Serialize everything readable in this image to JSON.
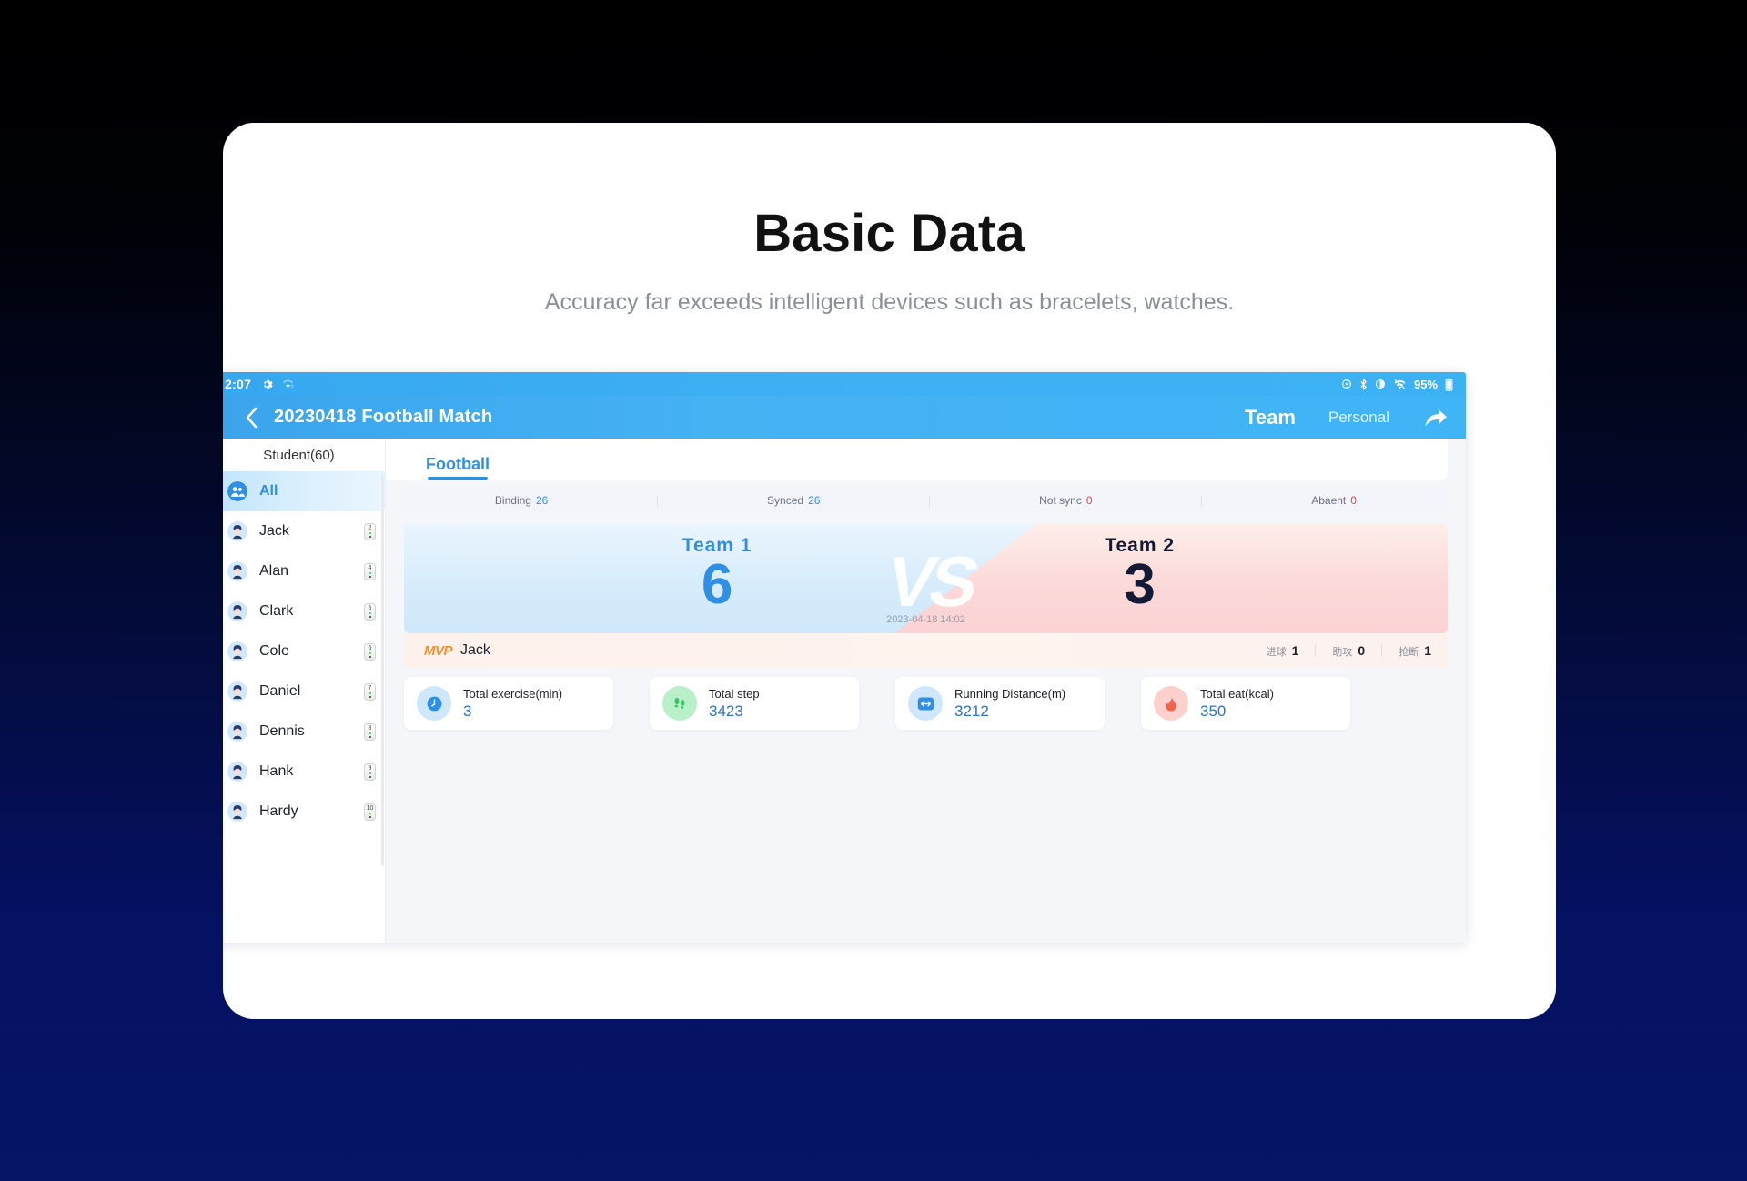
{
  "hero": {
    "title": "Basic Data",
    "subtitle": "Accuracy far exceeds intelligent devices such as bracelets, watches."
  },
  "status_bar": {
    "time": "2:07",
    "left_icons": [
      "gear-icon",
      "wifi-weak-icon"
    ],
    "right_icons": [
      "location-icon",
      "bluetooth-icon",
      "do-not-disturb-icon",
      "wifi-icon"
    ],
    "battery": "95%"
  },
  "nav": {
    "back": "back-arrow-icon",
    "title": "20230418 Football Match",
    "tab_team": "Team",
    "tab_personal": "Personal",
    "share": "share-icon"
  },
  "sidebar": {
    "header": "Student(60)",
    "all_label": "All",
    "students": [
      {
        "name": "Jack",
        "device": "2"
      },
      {
        "name": "Alan",
        "device": "4"
      },
      {
        "name": "Clark",
        "device": "5"
      },
      {
        "name": "Cole",
        "device": "6"
      },
      {
        "name": "Daniel",
        "device": "7"
      },
      {
        "name": "Dennis",
        "device": "8"
      },
      {
        "name": "Hank",
        "device": "9"
      },
      {
        "name": "Hardy",
        "device": "10"
      }
    ]
  },
  "content": {
    "tab": "Football",
    "sync_stats": [
      {
        "label": "Binding",
        "value": "26",
        "tone": "blue"
      },
      {
        "label": "Synced",
        "value": "26",
        "tone": "blue"
      },
      {
        "label": "Not sync",
        "value": "0",
        "tone": "red"
      },
      {
        "label": "Abaent",
        "value": "0",
        "tone": "red"
      }
    ],
    "match": {
      "team1_label": "Team  1",
      "team1_score": "6",
      "vs": "VS",
      "timestamp": "2023-04-18 14:02",
      "team2_label": "Team  2",
      "team2_score": "3"
    },
    "mvp": {
      "tag": "MVP",
      "name": "Jack",
      "stats": [
        {
          "label": "进球",
          "value": "1"
        },
        {
          "label": "助攻",
          "value": "0"
        },
        {
          "label": "抢断",
          "value": "1"
        }
      ]
    },
    "metrics": [
      {
        "icon": "clock-icon",
        "tone": "blue",
        "label": "Total exercise(min)",
        "value": "3"
      },
      {
        "icon": "footsteps-icon",
        "tone": "green",
        "label": "Total step",
        "value": "3423"
      },
      {
        "icon": "distance-icon",
        "tone": "blue",
        "label": "Running Distance(m)",
        "value": "3212"
      },
      {
        "icon": "flame-icon",
        "tone": "red",
        "label": "Total eat(kcal)",
        "value": "350"
      }
    ]
  },
  "colors": {
    "accent_blue": "#2f8fe5",
    "danger_red": "#f0433a",
    "mvp_orange": "#f0912f",
    "page_bg_top": "#000000",
    "page_bg_bottom": "#061566"
  }
}
